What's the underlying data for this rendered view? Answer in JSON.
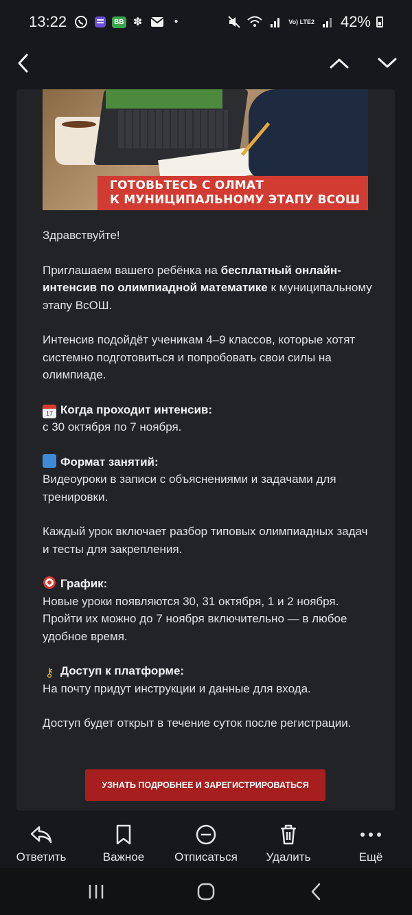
{
  "status_bar": {
    "time": "13:22",
    "battery_percent": "42%",
    "network": "Vo) LTE2",
    "badge": "BB",
    "icons_left": [
      "whatsapp-icon",
      "app-icon",
      "bb-badge-icon",
      "flower-icon",
      "mail-icon",
      "dot-icon"
    ],
    "icons_right": [
      "mute-icon",
      "wifi-icon",
      "signal-icon",
      "battery-icon"
    ]
  },
  "top_nav": {
    "icons": [
      "back-icon",
      "chevron-up-icon",
      "chevron-down-icon"
    ]
  },
  "banner": {
    "line1": "ГОТОВЬТЕСЬ С ОЛМАТ",
    "line2": "К МУНИЦИПАЛЬНОМУ ЭТАПУ ВСОШ",
    "accent_color": "#d23b32"
  },
  "email": {
    "greeting": "Здравствуйте!",
    "invite": {
      "pre": "Приглашаем вашего ребёнка на ",
      "bold": "бесплатный онлайн-интенсив по олимпиадной математике",
      "post": " к муниципальному этапу ВсОШ."
    },
    "audience": "Интенсив подойдёт ученикам 4–9 классов, которые хотят системно подготовиться и попробовать свои силы на олимпиаде.",
    "when_heading": "Когда проходит интенсив:",
    "when_text": "с 30 октября по 7 ноября.",
    "format_heading": "Формат занятий:",
    "format_text": "Видеоуроки в записи с объяснениями и задачами для тренировки.",
    "lesson_text": "Каждый урок включает разбор типовых олимпиадных задач и тесты для закрепления.",
    "schedule_heading": "График:",
    "schedule_text": "Новые уроки появляются 30, 31 октября, 1 и 2 ноября. Пройти их можно до 7 ноября включительно — в любое удобное время.",
    "access_heading": "Доступ к платформе:",
    "access_text": "На почту придут инструкции и данные для входа.",
    "access_note": "Доступ будет открыт в течение суток после регистрации.",
    "cta_label": "УЗНАТЬ ПОДРОБНЕЕ И ЗАРЕГИСТРИРОВАТЬСЯ",
    "cta_color": "#a61f1e",
    "emoji": [
      "calendar-icon",
      "book-icon",
      "target-icon",
      "key-icon"
    ]
  },
  "toolbar": {
    "items": [
      {
        "label": "Ответить",
        "icon": "reply-icon"
      },
      {
        "label": "Важное",
        "icon": "bookmark-icon"
      },
      {
        "label": "Отписаться",
        "icon": "unsubscribe-icon"
      },
      {
        "label": "Удалить",
        "icon": "trash-icon"
      },
      {
        "label": "Ещё",
        "icon": "more-icon"
      }
    ]
  },
  "system_nav": {
    "icons": [
      "recents-icon",
      "home-icon",
      "back-icon"
    ]
  }
}
